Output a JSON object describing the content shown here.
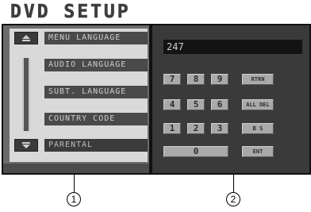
{
  "title": "DVD SETUP",
  "menu": {
    "items": [
      "MENU LANGUAGE",
      "AUDIO LANGUAGE",
      "SUBT. LANGUAGE",
      "COUNTRY CODE",
      "PARENTAL"
    ]
  },
  "keypad": {
    "display_value": "247",
    "keys": {
      "k7": "7",
      "k8": "8",
      "k9": "9",
      "k4": "4",
      "k5": "5",
      "k6": "6",
      "k1": "1",
      "k2": "2",
      "k3": "3",
      "k0": "0",
      "return": "RTRN",
      "all_del": "ALL DEL",
      "bs": "B S",
      "ent": "ENT"
    }
  },
  "callouts": {
    "left": "1",
    "right": "2"
  },
  "colors": {
    "panel_bg": "#3a3a3a",
    "key_bg": "#a9a9a9",
    "menu_item_bg": "#4a4a4a"
  },
  "icons": {
    "scroll_up": "arrow-up-icon",
    "scroll_down": "arrow-down-icon"
  }
}
